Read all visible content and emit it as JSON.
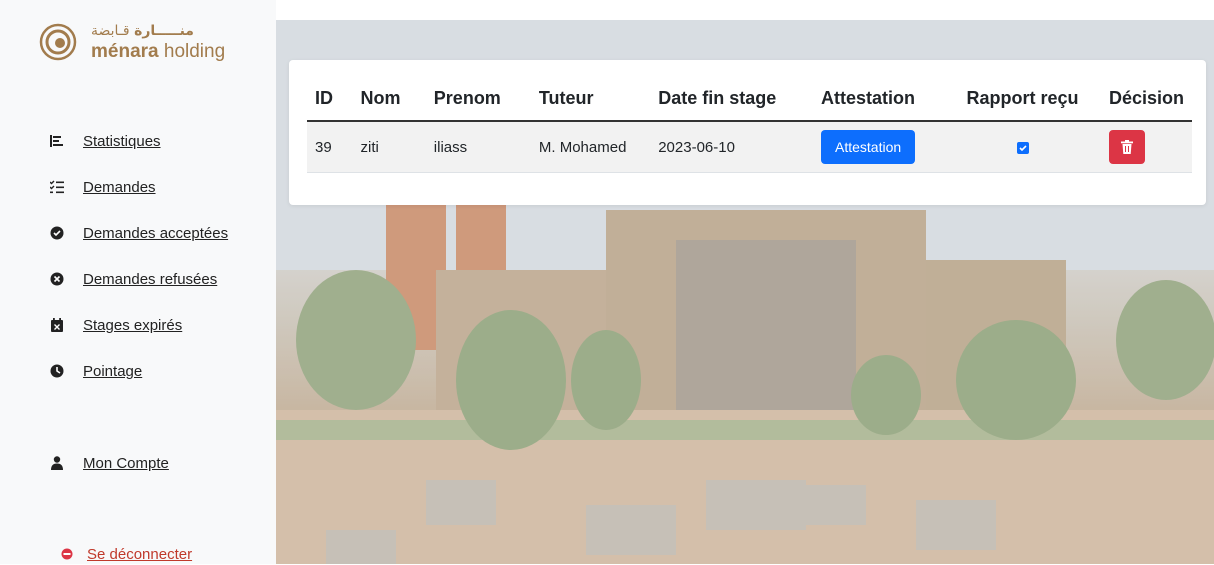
{
  "brand": {
    "arabic_name": "منـــــارة",
    "arabic_sub": "قـابضة",
    "latin_bold": "ménara",
    "latin_rest": " holding"
  },
  "sidebar": {
    "items": [
      {
        "label": "Statistiques",
        "icon": "list-icon"
      },
      {
        "label": "Demandes",
        "icon": "checklist-icon"
      },
      {
        "label": "Demandes acceptées",
        "icon": "check-circle-icon"
      },
      {
        "label": "Demandes refusées",
        "icon": "x-circle-icon"
      },
      {
        "label": "Stages expirés",
        "icon": "calendar-x-icon"
      },
      {
        "label": "Pointage",
        "icon": "clock-icon"
      }
    ],
    "account": {
      "label": "Mon Compte",
      "icon": "user-icon"
    },
    "logout": {
      "label": "Se déconnecter",
      "icon": "logout-icon",
      "color": "#dc3545"
    }
  },
  "table": {
    "headers": [
      "ID",
      "Nom",
      "Prenom",
      "Tuteur",
      "Date fin stage",
      "Attestation",
      "Rapport reçu",
      "Décision"
    ],
    "rows": [
      {
        "id": "39",
        "nom": "ziti",
        "prenom": "iliass",
        "tuteur": "M. Mohamed",
        "date_fin": "2023-06-10",
        "attestation_label": "Attestation",
        "rapport_recu": true
      }
    ]
  },
  "colors": {
    "primary": "#0d6efd",
    "danger": "#dc3545",
    "brand": "#a27c4d"
  }
}
